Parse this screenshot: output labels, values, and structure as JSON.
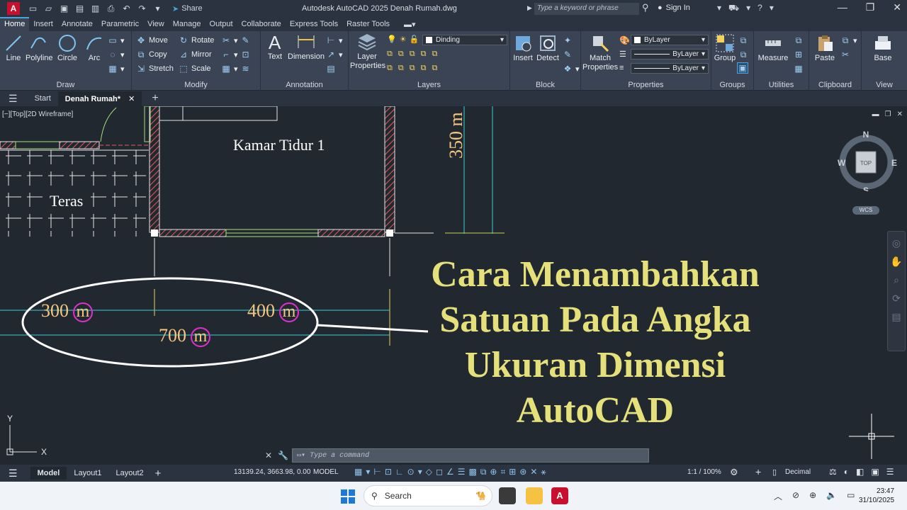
{
  "window": {
    "title": "Autodesk AutoCAD 2025   Denah Rumah.dwg",
    "share_label": "Share",
    "search_placeholder": "Type a keyword or phrase",
    "sign_in": "Sign In"
  },
  "ribbon_tabs": [
    "Home",
    "Insert",
    "Annotate",
    "Parametric",
    "View",
    "Manage",
    "Output",
    "Collaborate",
    "Express Tools",
    "Raster Tools"
  ],
  "ribbon": {
    "draw": {
      "label": "Draw",
      "tools": [
        "Line",
        "Polyline",
        "Circle",
        "Arc"
      ]
    },
    "modify": {
      "label": "Modify",
      "tools": [
        "Move",
        "Rotate",
        "Copy",
        "Mirror",
        "Stretch",
        "Scale"
      ]
    },
    "annotation": {
      "label": "Annotation",
      "tools": [
        "Text",
        "Dimension"
      ]
    },
    "layers": {
      "label": "Layers",
      "layer_properties": "Layer Properties",
      "current_layer": "Dinding"
    },
    "block": {
      "label": "Block",
      "tools": [
        "Insert",
        "Detect"
      ]
    },
    "properties": {
      "label": "Properties",
      "match": "Match Properties",
      "color": "ByLayer",
      "linetype": "ByLayer",
      "lineweight": "ByLayer"
    },
    "groups": {
      "label": "Groups",
      "tool": "Group"
    },
    "utilities": {
      "label": "Utilities",
      "tool": "Measure"
    },
    "clipboard": {
      "label": "Clipboard",
      "tool": "Paste"
    },
    "view": {
      "label": "View",
      "tool": "Base"
    }
  },
  "file_tabs": {
    "start": "Start",
    "active": "Denah Rumah*"
  },
  "viewport": {
    "label": "[−][Top][2D Wireframe]",
    "rooms": {
      "bedroom": "Kamar Tidur 1",
      "terrace": "Teras"
    },
    "dimensions": {
      "d1": "300",
      "d2": "400",
      "d3": "700",
      "unit": "m",
      "vertical": "350 m"
    },
    "headline": [
      "Cara Menambahkan",
      "Satuan Pada Angka",
      "Ukuran Dimensi",
      "AutoCAD"
    ],
    "compass": {
      "n": "N",
      "s": "S",
      "e": "E",
      "w": "W",
      "top": "TOP",
      "wcs": "WCS"
    },
    "ucs": {
      "x": "X",
      "y": "Y"
    },
    "command_placeholder": "Type a command"
  },
  "status_bar": {
    "tabs": [
      "Model",
      "Layout1",
      "Layout2"
    ],
    "coordinates": "13139.24, 3663.98, 0.00",
    "model": "MODEL",
    "scale": "1:1 / 100%",
    "units": "Decimal"
  },
  "taskbar": {
    "search": "Search",
    "time": "23:47",
    "date": "31/10/2025"
  },
  "colors": {
    "headline": "#e6e07a",
    "dimension_text": "#f7c77f",
    "unit_circle": "#e02ecf",
    "wall": "#e5e5e5",
    "dimension_line": "#38d0d8"
  }
}
